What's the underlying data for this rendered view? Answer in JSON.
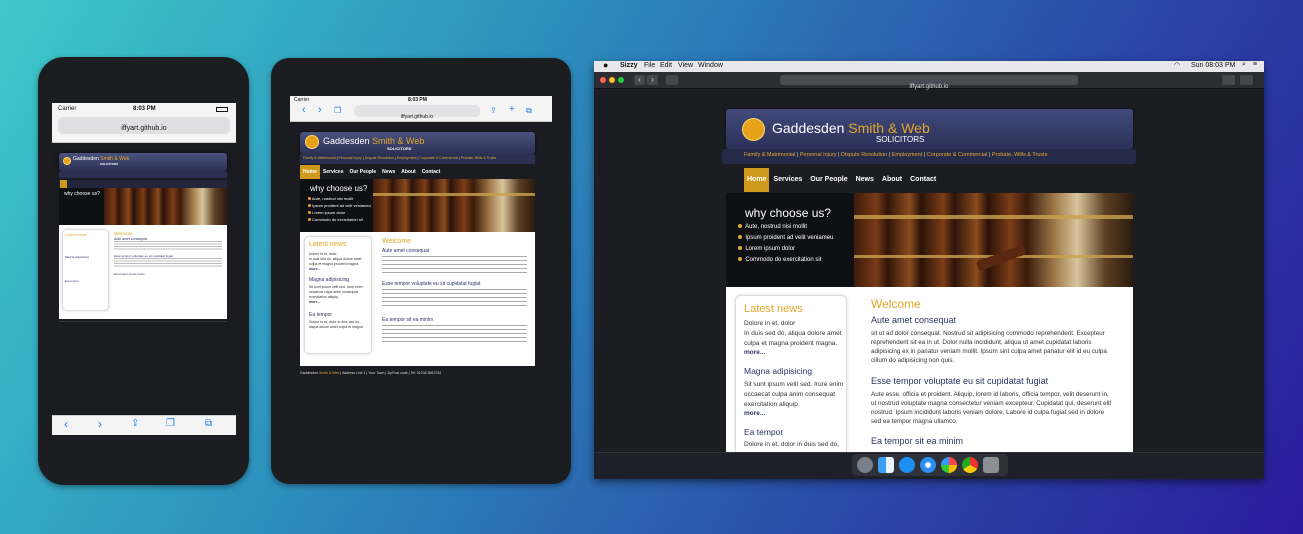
{
  "site": {
    "brand_main": "Gaddesden ",
    "brand_accent": "Smith & Web",
    "brand_sub": "SOLICITORS",
    "practice_links": [
      "Family & Matrimonial",
      "Personal Injury",
      "Dispute Resolution",
      "Employment",
      "Corporate & Commercial",
      "Probate, Wills & Trusts"
    ],
    "nav": [
      "Home",
      "Services",
      "Our People",
      "News",
      "About",
      "Contact"
    ],
    "hero_title": "why choose us?",
    "hero_points": [
      "Aute, nostrud nisi mollit",
      "Ipsum proident ad velit veniameu",
      "Lorem ipsum dolor",
      "Commodo do exercitation sit"
    ],
    "news_title": "Latest news",
    "news": [
      {
        "title": "",
        "lines": [
          "Dolore in et, dolor",
          "In duis sed do, aliqua dolore amet",
          "culpa et magna proident magna."
        ],
        "more": "more..."
      },
      {
        "title": "Magna adipisicing",
        "lines": [
          "Sit sunt ipsum velit sed. Irure enim",
          "occaecat culpa anim consequat",
          "exercitation aliquip."
        ],
        "more": "more..."
      },
      {
        "title": "Ea tempor",
        "lines": [
          "Dolore in et, dolor in duis sed do,",
          "aliqua dolore amet culpa et magna"
        ],
        "more": ""
      }
    ],
    "welcome": "Welcome",
    "sections": [
      {
        "title": "Aute amet consequat",
        "lines": [
          "sit ut ad dolor consequat. Nostrud sit adipisicing commodo reprehenderit. Excepteur",
          "reprehenderit sit ea in ut. Dolor nulla incididunt, aliqua ut amet cupidatat laboris",
          "adipisicing ex in pariatur veniam mollit. Ipsum sint culpa amet pariatur elit id eu culpa",
          "cillum do adipisicing non quis."
        ]
      },
      {
        "title": "Esse tempor voluptate eu sit cupidatat fugiat",
        "lines": [
          "Aute esse, officia et proident. Aliquip, lorem id laboris, officia tempor, velit deserunt in,",
          "ut nostrud voluptate magna consectetur veniam excepteur. Cupidatat qui, deserunt elit",
          "nostrud. Ipsum incididunt laboris veniam dolore. Labore id culpa fugiat sed in dolore",
          "sed ea tempor magna ullamco."
        ]
      },
      {
        "title": "Ea tempor sit ea minim",
        "lines": []
      }
    ],
    "footer": {
      "a": "Gaddesden ",
      "b": "Smith & Web",
      "c": " | Address Line 1 | Your Town | ZipPost code | Tel: 01234 5567234"
    }
  },
  "phone": {
    "carrier": "Carrier",
    "time": "8:03 PM",
    "url": "iffyart.github.io"
  },
  "tablet": {
    "carrier": "Carrier",
    "time": "8:03 PM",
    "url": "iffyart.github.io"
  },
  "desktop": {
    "menu": [
      "Sizzy",
      "File",
      "Edit",
      "View",
      "Window"
    ],
    "clock": "Sun 08:03 PM",
    "url": "iffyart.github.io"
  },
  "colors": {
    "accent": "#e3a82b",
    "navy": "#2d3466",
    "header": "#3b4270"
  }
}
